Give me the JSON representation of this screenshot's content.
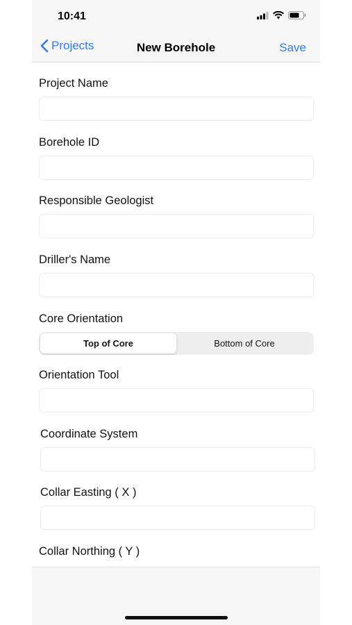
{
  "status_bar": {
    "time": "10:41"
  },
  "nav": {
    "back_label": "Projects",
    "title": "New Borehole",
    "save_label": "Save"
  },
  "fields": {
    "project_name": {
      "label": "Project Name",
      "value": ""
    },
    "borehole_id": {
      "label": "Borehole ID",
      "value": ""
    },
    "responsible_geologist": {
      "label": "Responsible Geologist",
      "value": ""
    },
    "drillers_name": {
      "label": "Driller's Name",
      "value": ""
    },
    "core_orientation": {
      "label": "Core Orientation",
      "options": [
        "Top of Core",
        "Bottom of Core"
      ],
      "selected": "Top of Core"
    },
    "orientation_tool": {
      "label": "Orientation Tool",
      "value": ""
    },
    "coordinate_system": {
      "label": "Coordinate System",
      "value": ""
    },
    "collar_easting": {
      "label": "Collar Easting ( X )",
      "value": ""
    },
    "collar_northing": {
      "label": "Collar Northing ( Y )"
    }
  },
  "colors": {
    "accent": "#2f7cf6",
    "bar_background": "#f6f6f6"
  }
}
